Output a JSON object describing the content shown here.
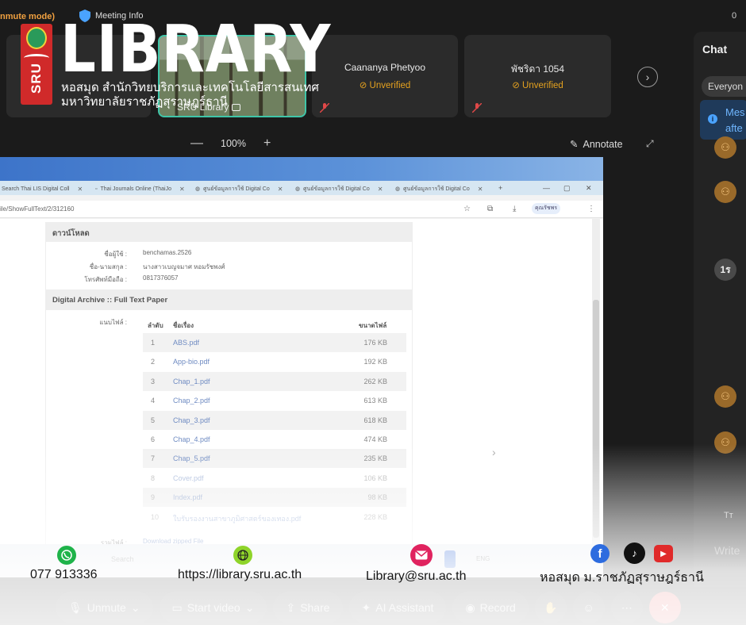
{
  "top_bar": {
    "unmute_mode": "nmute mode)",
    "meeting_info": "Meeting Info",
    "clock_fragment": "0"
  },
  "thumbnails": [
    {
      "name": "",
      "status": ""
    },
    {
      "name": "SRU Library",
      "status": ""
    },
    {
      "name": "Caananya Phetyoo",
      "status": "Unverified"
    },
    {
      "name": "พัชริดา 1054",
      "status": "Unverified"
    }
  ],
  "zoom": {
    "minus": "—",
    "level": "100%",
    "plus": "+"
  },
  "annotate": {
    "label": "Annotate"
  },
  "browser": {
    "tabs": [
      "Search Thai LIS Digital Coll",
      "Thai Journals Online (ThaiJo",
      "ศูนย์ข้อมูลการใช้ Digital Co",
      "ศูนย์ข้อมูลการใช้ Digital Co",
      "ศูนย์ข้อมูลการใช้ Digital Co"
    ],
    "url": "ile/ShowFullText/2/312160",
    "profile_label": "คุณรัชพร"
  },
  "download_box": {
    "title": "ดาวน์โหลด",
    "rows": [
      {
        "label": "ชื่อผู้ใช้ :",
        "value": "benchamas.2526"
      },
      {
        "label": "ชื่อ-นามสกุล :",
        "value": "นางสาวเบญจมาศ หอมรัชพงศ์"
      },
      {
        "label": "โทรศัพท์มือถือ :",
        "value": "0817376057"
      }
    ]
  },
  "archive_box": {
    "title": "Digital Archive :: Full Text Paper",
    "attachment_label": "แนบไฟล์ :",
    "col_no": "ลำดับ",
    "col_title": "ชื่อเรื่อง",
    "col_size": "ขนาดไฟล์",
    "files": [
      {
        "no": "1",
        "name": "ABS.pdf",
        "size": "176 KB"
      },
      {
        "no": "2",
        "name": "App-bio.pdf",
        "size": "192 KB"
      },
      {
        "no": "3",
        "name": "Chap_1.pdf",
        "size": "262 KB"
      },
      {
        "no": "4",
        "name": "Chap_2.pdf",
        "size": "613 KB"
      },
      {
        "no": "5",
        "name": "Chap_3.pdf",
        "size": "618 KB"
      },
      {
        "no": "6",
        "name": "Chap_4.pdf",
        "size": "474 KB"
      },
      {
        "no": "7",
        "name": "Chap_5.pdf",
        "size": "235 KB"
      },
      {
        "no": "8",
        "name": "Cover.pdf",
        "size": "106 KB"
      },
      {
        "no": "9",
        "name": "Index.pdf",
        "size": "98 KB"
      },
      {
        "no": "10",
        "name": "ใบรับรองงานสาขาภูมิศาสตร์ของเทอง.pdf",
        "size": "228 KB"
      }
    ],
    "zip_label": "รวมไฟล์ :",
    "zip_link": "Download zipped File"
  },
  "taskbar": {
    "search": "Search",
    "lang": "ENG"
  },
  "chat": {
    "title": "Chat",
    "recipient": "Everyon",
    "info_line1": "Mes",
    "info_line2": "afte",
    "avatar_initials": "1ร",
    "format": "Tт",
    "write": "Write"
  },
  "controls": {
    "unmute": "Unmute",
    "start_video": "Start video",
    "share": "Share",
    "ai_assistant": "AI Assistant",
    "record": "Record"
  },
  "brand": {
    "sru": "SRU",
    "title": "LIBRARY",
    "sub1": "หอสมุด สำนักวิทยบริการและเทคโนโลยีสารสนเทศ",
    "sub2": "มหาวิทยาลัยราชภัฏสุราษฎร์ธานี"
  },
  "contact": {
    "phone": "077 913336",
    "website": "https://library.sru.ac.th",
    "email": "Library@sru.ac.th",
    "social": "หอสมุด ม.ราชภัฏสุราษฎร์ธานี"
  },
  "colors": {
    "accent_green": "#3fc5a8",
    "warning": "#e5a21f",
    "brand_red": "#d02a2a",
    "end_red": "#e04848"
  }
}
